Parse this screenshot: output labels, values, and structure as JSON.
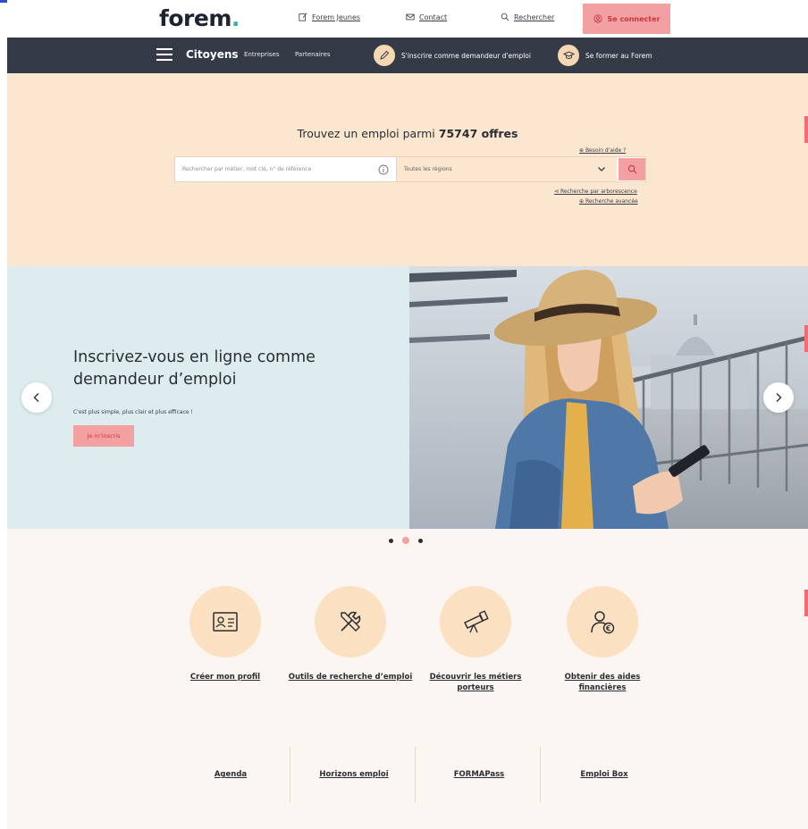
{
  "header": {
    "logo": "forem",
    "logo_dot": ".",
    "links": [
      {
        "label": "Forem Jeunes",
        "icon": "edit-icon"
      },
      {
        "label": "Contact",
        "icon": "mail-icon"
      },
      {
        "label": "Rechercher",
        "icon": "search-icon"
      }
    ],
    "connect_label": "Se connecter",
    "connect_icon": "user-circle-icon"
  },
  "nav": {
    "active": "Citoyens",
    "items": [
      "Entreprises",
      "Partenaires"
    ],
    "pills": [
      {
        "label": "S'inscrire comme demandeur d'emploi",
        "icon": "pen-icon"
      },
      {
        "label": "Se former au Forem",
        "icon": "graduation-icon"
      }
    ]
  },
  "search": {
    "title_prefix": "Trouvez un emploi parmi",
    "count": "75747 offres",
    "help": "Besoin d'aide ?",
    "placeholder": "Rechercher par métier, mot clé, n° de référence",
    "region": "Toutes les régions",
    "tree_search": "Recherche par arborescence",
    "advanced_search": "Recherche avancée"
  },
  "banner": {
    "title": "Inscrivez-vous en ligne comme demandeur d’emploi",
    "subtitle": "C'est plus simple, plus clair et plus efficace !",
    "button": "Je m'inscris",
    "slide_count": 3,
    "active_slide": 2
  },
  "services": [
    {
      "label": "Créer mon profil",
      "icon": "id-card-icon"
    },
    {
      "label": "Outils de recherche d’emploi",
      "icon": "tools-icon"
    },
    {
      "label": "Découvrir les métiers porteurs",
      "icon": "telescope-icon"
    },
    {
      "label": "Obtenir des aides financières",
      "icon": "user-euro-icon"
    }
  ],
  "bottom_links": [
    "Agenda",
    "Horizons emploi",
    "FORMAPass",
    "Emploi Box"
  ],
  "colors": {
    "navbar": "#343b47",
    "accent_pink": "#f3a0a3",
    "hero_peach": "#fbe6cf",
    "banner_blue": "#dcecef"
  }
}
